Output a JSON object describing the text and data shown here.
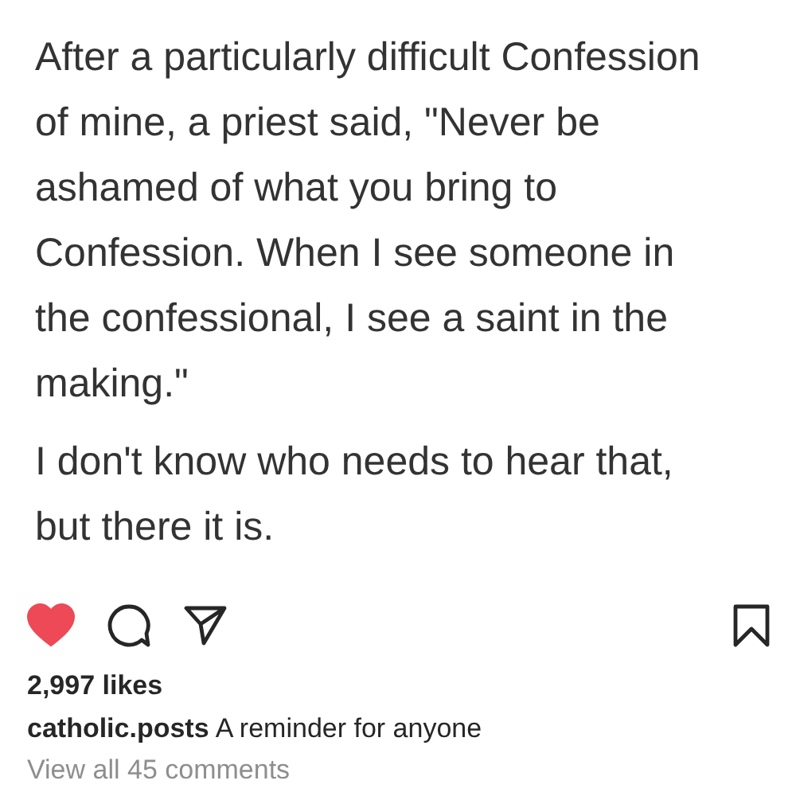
{
  "post_text": {
    "paragraphs": [
      {
        "lines": [
          "After a particularly difficult Confession",
          "of mine, a priest said, \"Never be",
          "ashamed of what you bring to",
          "Confession.  When I see someone in",
          "the confessional, I see a saint in the",
          "making.\""
        ]
      },
      {
        "lines": [
          "I don't know who needs to hear that,",
          "but there it is."
        ]
      }
    ]
  },
  "actions": {
    "liked": true,
    "saved": false
  },
  "likes": "2,997 likes",
  "caption": {
    "username": "catholic.posts",
    "text": "A reminder for anyone"
  },
  "comments_link": "View all 45 comments"
}
